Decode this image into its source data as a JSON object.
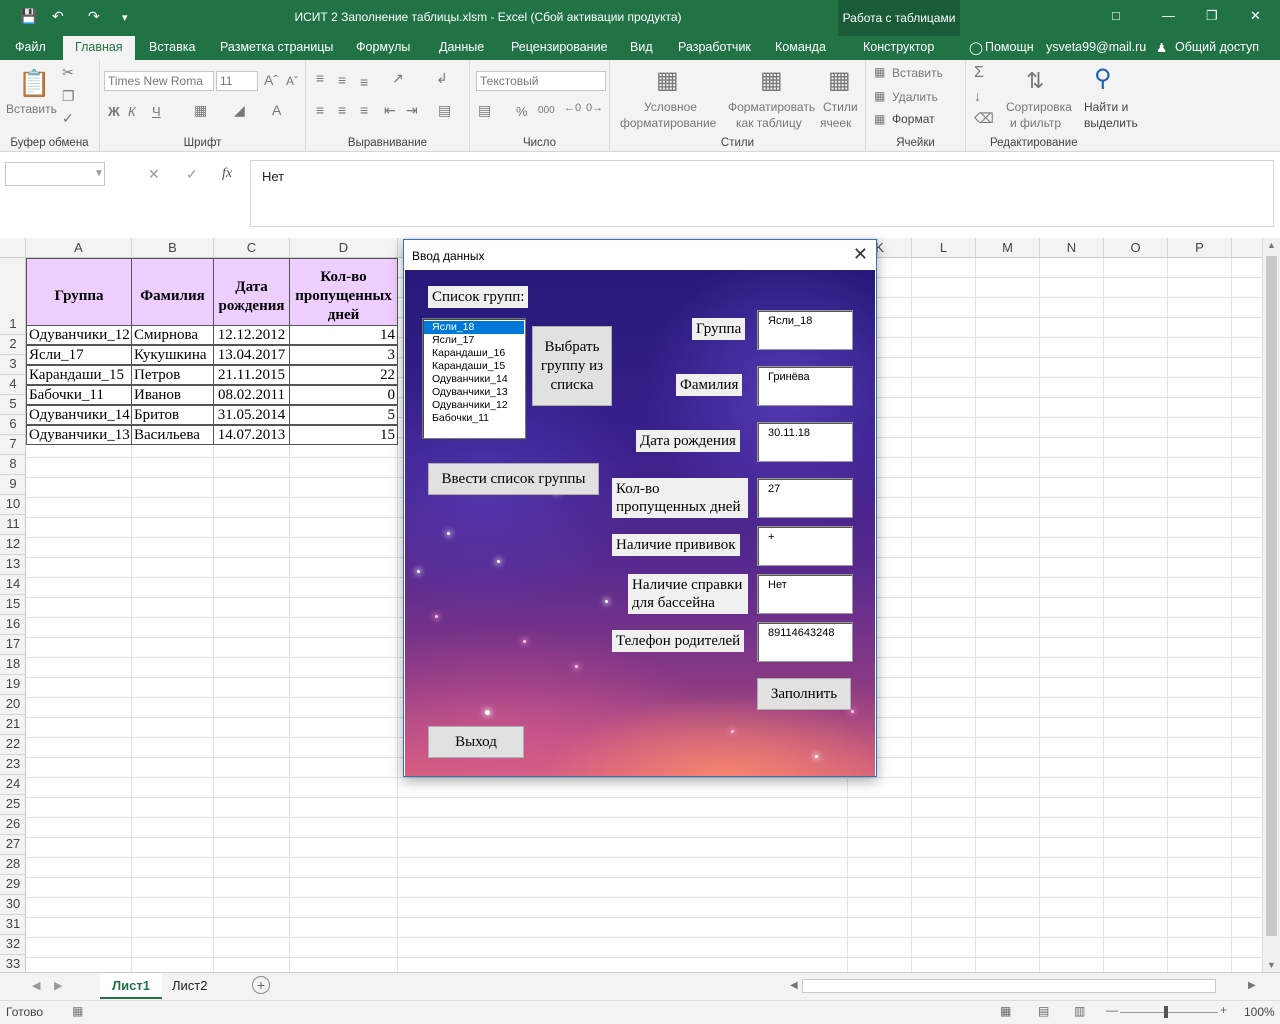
{
  "titlebar": {
    "title": "ИСИТ 2 Заполнение таблицы.xlsm - Excel (Сбой активации продукта)",
    "context_tab": "Работа с таблицами"
  },
  "tabs": {
    "file": "Файл",
    "home": "Главная",
    "insert": "Вставка",
    "layout": "Разметка страницы",
    "formulas": "Формулы",
    "data": "Данные",
    "review": "Рецензирование",
    "view": "Вид",
    "developer": "Разработчик",
    "team": "Команда",
    "design": "Конструктор",
    "help": "Помощн",
    "user": "ysveta99@mail.ru",
    "share": "Общий доступ"
  },
  "ribbon": {
    "paste": "Вставить",
    "clipboard": "Буфер обмена",
    "font_name": "Times New Roma",
    "font_size": "11",
    "font_group": "Шрифт",
    "alignment_group": "Выравнивание",
    "number_format": "Текстовый",
    "number_group": "Число",
    "cond_format_1": "Условное",
    "cond_format_2": "форматирование",
    "format_table_1": "Форматировать",
    "format_table_2": "как таблицу",
    "cell_styles_1": "Стили",
    "cell_styles_2": "ячеек",
    "styles_group": "Стили",
    "insert_cells": "Вставить",
    "delete_cells": "Удалить",
    "format_cells": "Формат",
    "cells_group": "Ячейки",
    "sort_filter_1": "Сортировка",
    "sort_filter_2": "и фильтр",
    "find_select_1": "Найти и",
    "find_select_2": "выделить",
    "editing_group": "Редактирование",
    "bold": "Ж",
    "italic": "К",
    "underline": "Ч",
    "percent": "%",
    "thousands": "000",
    "fx": "fx"
  },
  "formula_bar": {
    "name_box": "",
    "value": "Нет"
  },
  "columns": [
    "A",
    "B",
    "C",
    "D",
    "K",
    "L",
    "M",
    "N",
    "O",
    "P"
  ],
  "rows": [
    "1",
    "2",
    "3",
    "4",
    "5",
    "6",
    "7",
    "8",
    "9",
    "10",
    "11",
    "12",
    "13",
    "14",
    "15",
    "16",
    "17",
    "18",
    "19",
    "20",
    "21",
    "22",
    "23",
    "24",
    "25",
    "26",
    "27",
    "28",
    "29",
    "30",
    "31",
    "32",
    "33",
    "34"
  ],
  "table": {
    "headers": [
      "Группа",
      "Фамилия",
      "Дата рождения",
      "Кол-во пропущенных дней"
    ],
    "data": [
      [
        "Одуванчики_12",
        "Смирнова",
        "12.12.2012",
        "14"
      ],
      [
        "Ясли_17",
        "Кукушкина",
        "13.04.2017",
        "3"
      ],
      [
        "Карандаши_15",
        "Петров",
        "21.11.2015",
        "22"
      ],
      [
        "Бабочки_11",
        "Иванов",
        "08.02.2011",
        "0"
      ],
      [
        "Одуванчики_14",
        "Бритов",
        "31.05.2014",
        "5"
      ],
      [
        "Одуванчики_13",
        "Васильева",
        "14.07.2013",
        "15"
      ]
    ]
  },
  "sheets": {
    "sheet1": "Лист1",
    "sheet2": "Лист2"
  },
  "status": {
    "ready": "Готово",
    "zoom": "100%"
  },
  "dialog": {
    "title": "Ввод данных",
    "group_list_label": "Список групп:",
    "group_list": [
      "Ясли_18",
      "Ясли_17",
      "Карандаши_16",
      "Карандаши_15",
      "Одуванчики_14",
      "Одуванчики_13",
      "Одуванчики_12",
      "Бабочки_11"
    ],
    "selected_group": "Ясли_18",
    "choose_group_button": "Выбрать группу из списка",
    "enter_group_list_button": "Ввести список группы",
    "exit_button": "Выход",
    "fill_button": "Заполнить",
    "fields": [
      {
        "label": "Группа",
        "value": "Ясли_18"
      },
      {
        "label": "Фамилия",
        "value": "Гринёва"
      },
      {
        "label": "Дата рождения",
        "value": "30.11.18"
      },
      {
        "label": "Кол-во пропущенных дней",
        "value": "27"
      },
      {
        "label": "Наличие прививок",
        "value": "+"
      },
      {
        "label": "Наличие справки для бассейна",
        "value": "Нет"
      },
      {
        "label": "Телефон родителей",
        "value": "89114643248"
      }
    ]
  },
  "colors": {
    "excel_green": "#217346",
    "header_fill": "#eecdff",
    "selection_blue": "#0078d7"
  }
}
